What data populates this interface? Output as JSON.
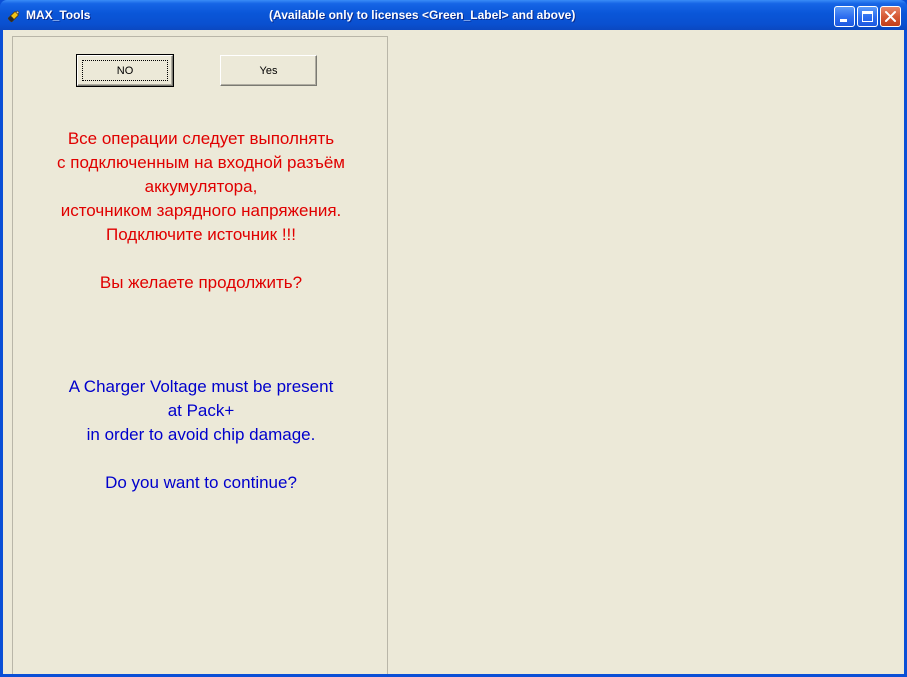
{
  "window": {
    "app_title": "MAX_Tools",
    "caption": "(Available only to licenses <Green_Label> and above)",
    "icon": "battery-icon",
    "colors": {
      "titlebar": "#0a50d0",
      "face": "#ece9d8",
      "close": "#d65a35"
    }
  },
  "buttons": {
    "no_label": "NO",
    "yes_label": "Yes"
  },
  "message_ru": {
    "color": "#e00000",
    "line1": "Все операции следует выполнять",
    "line2": "с подключенным на входной разъём",
    "line3": "аккумулятора,",
    "line4": "источником зарядного напряжения.",
    "line5": "Подключите источник !!!",
    "question": "Вы желаете продолжить?"
  },
  "message_en": {
    "color": "#0000cc",
    "line1": "A Charger Voltage must be present",
    "line2": "at Pack+",
    "line3": "in order to avoid chip damage.",
    "question": "Do you want to continue?"
  }
}
